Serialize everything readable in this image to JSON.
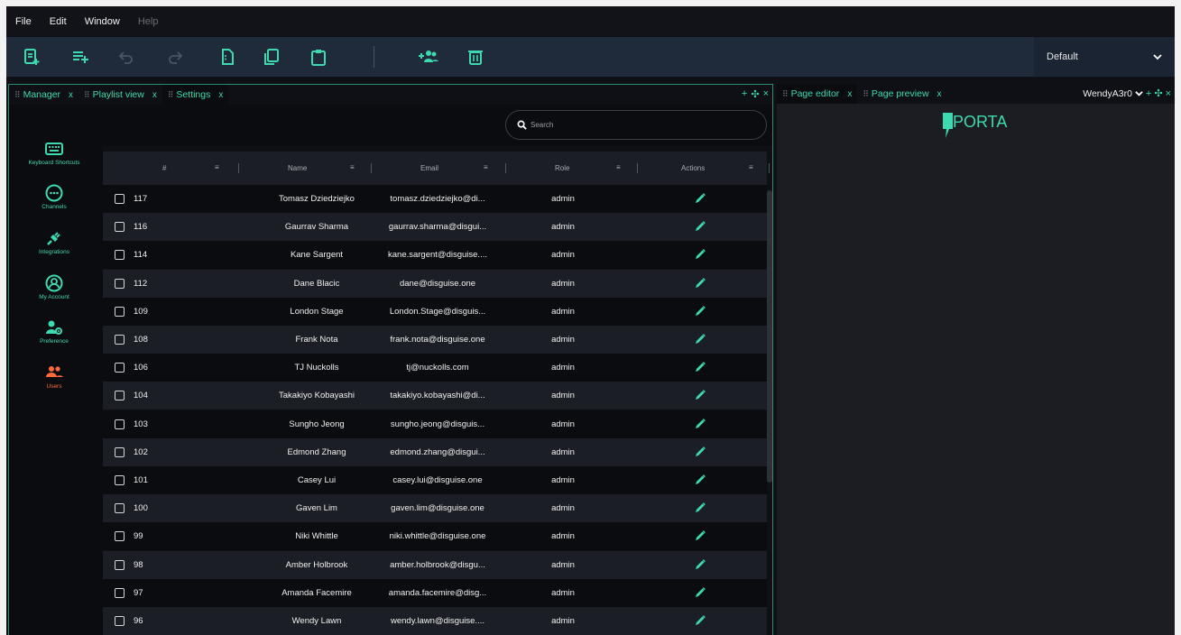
{
  "menu": [
    "File",
    "Edit",
    "Window",
    "Help"
  ],
  "layout_select": "Default",
  "left_tabs": [
    {
      "label": "Manager",
      "close": "x"
    },
    {
      "label": "Playlist view",
      "close": "x"
    },
    {
      "label": "Settings",
      "close": "x"
    }
  ],
  "dock_controls": [
    "+",
    "✣",
    "×"
  ],
  "right_tabs": [
    {
      "label": "Page editor",
      "close": "x"
    },
    {
      "label": "Page preview",
      "close": "x"
    }
  ],
  "right_selector": "WendyA3r0",
  "logo_text": "PORTA",
  "sidebar": [
    {
      "label": "Keyboard Shortcuts",
      "icon": "keyboard-icon"
    },
    {
      "label": "Channels",
      "icon": "channels-icon"
    },
    {
      "label": "Integrations",
      "icon": "plug-icon"
    },
    {
      "label": "My Account",
      "icon": "account-icon"
    },
    {
      "label": "Preference",
      "icon": "user-settings-icon"
    },
    {
      "label": "Users",
      "icon": "users-icon"
    }
  ],
  "search": {
    "placeholder": "Search"
  },
  "table": {
    "columns": [
      "#",
      "Name",
      "Email",
      "Role",
      "Actions"
    ],
    "rows": [
      {
        "id": "117",
        "name": "Tomasz Dziedziejko",
        "email": "tomasz.dziedziejko@di...",
        "role": "admin"
      },
      {
        "id": "116",
        "name": "Gaurrav Sharma",
        "email": "gaurrav.sharma@disgui...",
        "role": "admin"
      },
      {
        "id": "114",
        "name": "Kane Sargent",
        "email": "kane.sargent@disguise....",
        "role": "admin"
      },
      {
        "id": "112",
        "name": "Dane Blacic",
        "email": "dane@disguise.one",
        "role": "admin"
      },
      {
        "id": "109",
        "name": "London Stage",
        "email": "London.Stage@disguis...",
        "role": "admin"
      },
      {
        "id": "108",
        "name": "Frank Nota",
        "email": "frank.nota@disguise.one",
        "role": "admin"
      },
      {
        "id": "106",
        "name": "TJ Nuckolls",
        "email": "tj@nuckolls.com",
        "role": "admin"
      },
      {
        "id": "104",
        "name": "Takakiyo Kobayashi",
        "email": "takakiyo.kobayashi@di...",
        "role": "admin"
      },
      {
        "id": "103",
        "name": "Sungho Jeong",
        "email": "sungho.jeong@disguis...",
        "role": "admin"
      },
      {
        "id": "102",
        "name": "Edmond Zhang",
        "email": "edmond.zhang@disgui...",
        "role": "admin"
      },
      {
        "id": "101",
        "name": "Casey Lui",
        "email": "casey.lui@disguise.one",
        "role": "admin"
      },
      {
        "id": "100",
        "name": "Gaven Lim",
        "email": "gaven.lim@disguise.one",
        "role": "admin"
      },
      {
        "id": "99",
        "name": "Niki Whittle",
        "email": "niki.whittle@disguise.one",
        "role": "admin"
      },
      {
        "id": "98",
        "name": "Amber Holbrook",
        "email": "amber.holbrook@disgu...",
        "role": "admin"
      },
      {
        "id": "97",
        "name": "Amanda Facemire",
        "email": "amanda.facemire@disg...",
        "role": "admin"
      },
      {
        "id": "96",
        "name": "Wendy Lawn",
        "email": "wendy.lawn@disguise....",
        "role": "admin"
      }
    ]
  },
  "colors": {
    "accent": "#3ed9b0",
    "active_nav": "#ff6b3d",
    "toolbar_bg": "#1f2a3a",
    "row_dark": "#0b0c10",
    "row_light": "#1b1e24"
  }
}
